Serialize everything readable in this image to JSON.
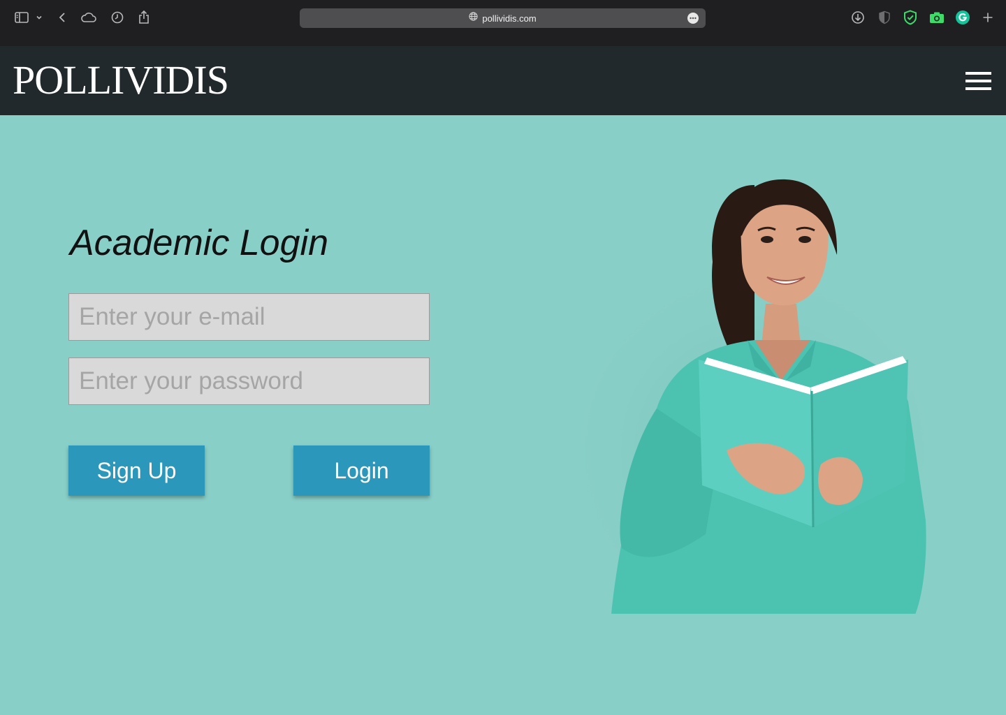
{
  "browser": {
    "url": "pollividis.com"
  },
  "site": {
    "logo": "POLLIVIDIS"
  },
  "login": {
    "title": "Academic Login",
    "email_placeholder": "Enter your e-mail",
    "password_placeholder": "Enter your password",
    "signup_label": "Sign Up",
    "login_label": "Login"
  },
  "icons": [
    "sidebar-icon",
    "chevron-down-icon",
    "back-icon",
    "cloud-icon",
    "history-icon",
    "share-icon",
    "globe-icon",
    "more-icon",
    "download-icon",
    "shield-half-icon",
    "shield-check-icon",
    "camera-icon",
    "grammarly-icon",
    "plus-icon",
    "menu-icon"
  ],
  "colors": {
    "page_background": "#88cfc7",
    "header_background": "#22292c",
    "button": "#2b97bb",
    "input_background": "#d9d9d9"
  }
}
